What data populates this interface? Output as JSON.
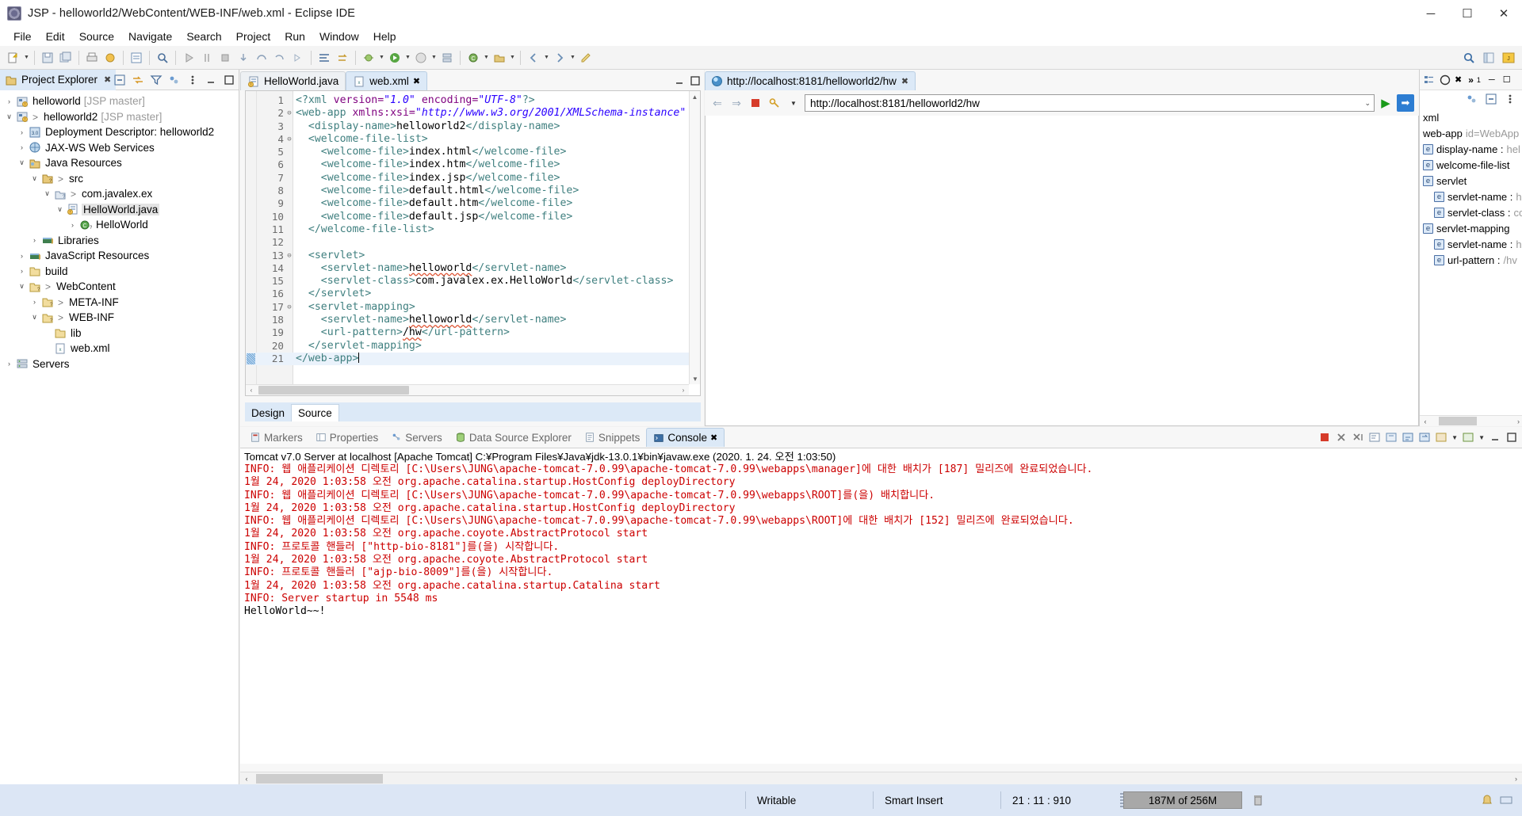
{
  "window": {
    "title": "JSP - helloworld2/WebContent/WEB-INF/web.xml - Eclipse IDE",
    "app_icon": "eclipse-icon",
    "minimize": "─",
    "maximize": "☐",
    "close": "✕"
  },
  "menu": {
    "items": [
      "File",
      "Edit",
      "Source",
      "Navigate",
      "Search",
      "Project",
      "Run",
      "Window",
      "Help"
    ]
  },
  "project_explorer": {
    "tab_label": "Project Explorer",
    "close_glyph": "✖",
    "tools": [
      "collapse-all-icon",
      "link-with-editor-icon",
      "view-filter-icon",
      "sync-icon",
      "view-menu-icon",
      "minimize-icon",
      "maximize-icon"
    ],
    "tree": [
      {
        "indent": 0,
        "twist": "›",
        "icon": "java-project-icon",
        "gt": "",
        "name": "helloworld",
        "suffix": "[JSP master]",
        "selected": false
      },
      {
        "indent": 0,
        "twist": "∨",
        "icon": "java-project-warn-icon",
        "gt": ">",
        "name": "helloworld2",
        "suffix": "[JSP master]",
        "selected": false
      },
      {
        "indent": 1,
        "twist": "›",
        "icon": "deployment-descriptor-icon",
        "gt": "",
        "name": "Deployment Descriptor: helloworld2",
        "suffix": "",
        "selected": false
      },
      {
        "indent": 1,
        "twist": "›",
        "icon": "jaxws-icon",
        "gt": "",
        "name": "JAX-WS Web Services",
        "suffix": "",
        "selected": false
      },
      {
        "indent": 1,
        "twist": "∨",
        "icon": "java-resources-icon",
        "gt": "",
        "name": "Java Resources",
        "suffix": "",
        "selected": false
      },
      {
        "indent": 2,
        "twist": "∨",
        "icon": "source-folder-icon",
        "gt": ">",
        "name": "src",
        "suffix": "",
        "selected": false
      },
      {
        "indent": 3,
        "twist": "∨",
        "icon": "package-icon",
        "gt": ">",
        "name": "com.javalex.ex",
        "suffix": "",
        "selected": false
      },
      {
        "indent": 4,
        "twist": "∨",
        "icon": "java-file-warn-icon",
        "gt": "",
        "name": "HelloWorld.java",
        "suffix": "",
        "selected": true
      },
      {
        "indent": 5,
        "twist": "›",
        "icon": "class-icon",
        "gt": "",
        "name": "HelloWorld",
        "suffix": "",
        "selected": false
      },
      {
        "indent": 2,
        "twist": "›",
        "icon": "library-icon",
        "gt": "",
        "name": "Libraries",
        "suffix": "",
        "selected": false
      },
      {
        "indent": 1,
        "twist": "›",
        "icon": "library-icon",
        "gt": "",
        "name": "JavaScript Resources",
        "suffix": "",
        "selected": false
      },
      {
        "indent": 1,
        "twist": "›",
        "icon": "folder-icon",
        "gt": "",
        "name": "build",
        "suffix": "",
        "selected": false
      },
      {
        "indent": 1,
        "twist": "∨",
        "icon": "folder-q-icon",
        "gt": ">",
        "name": "WebContent",
        "suffix": "",
        "selected": false
      },
      {
        "indent": 2,
        "twist": "›",
        "icon": "folder-q-icon",
        "gt": ">",
        "name": "META-INF",
        "suffix": "",
        "selected": false
      },
      {
        "indent": 2,
        "twist": "∨",
        "icon": "folder-q-icon",
        "gt": ">",
        "name": "WEB-INF",
        "suffix": "",
        "selected": false
      },
      {
        "indent": 3,
        "twist": "",
        "icon": "folder-icon",
        "gt": "",
        "name": "lib",
        "suffix": "",
        "selected": false
      },
      {
        "indent": 3,
        "twist": "",
        "icon": "xml-file-icon",
        "gt": "",
        "name": "web.xml",
        "suffix": "",
        "selected": false
      },
      {
        "indent": 0,
        "twist": "›",
        "icon": "servers-icon",
        "gt": "",
        "name": "Servers",
        "suffix": "",
        "selected": false
      }
    ]
  },
  "editor": {
    "tabs": [
      {
        "label": "HelloWorld.java",
        "icon": "java-file-warn-icon",
        "active": false,
        "closeable": false
      },
      {
        "label": "web.xml",
        "icon": "xml-file-icon",
        "active": true,
        "closeable": true
      }
    ],
    "close_glyph": "✖",
    "bottom_tabs": [
      {
        "label": "Design",
        "active": false
      },
      {
        "label": "Source",
        "active": true
      }
    ],
    "lines": [
      {
        "n": "1",
        "fold": "",
        "current": false,
        "html": "<span class='k-pi'>&lt;?xml </span><span class='k-attr'>version=</span><span class='k-str'>\"1.0\"</span><span class='k-attr'> encoding=</span><span class='k-str'>\"UTF-8\"</span><span class='k-pi'>?&gt;</span>"
      },
      {
        "n": "2",
        "fold": "⊖",
        "current": false,
        "html": "<span class='k-tag'>&lt;web-app </span><span class='k-attr'>xmlns:xsi=</span><span class='k-str'>\"http://www.w3.org/2001/XMLSchema-instance\"</span><span class='k-attr'> xmlns=</span><span class='k-str'>\"</span>"
      },
      {
        "n": "3",
        "fold": "",
        "current": false,
        "html": "  <span class='k-tag'>&lt;display-name&gt;</span><span class='k-txt'>helloworld2</span><span class='k-tag'>&lt;/display-name&gt;</span>"
      },
      {
        "n": "4",
        "fold": "⊖",
        "current": false,
        "html": "  <span class='k-tag'>&lt;welcome-file-list&gt;</span>"
      },
      {
        "n": "5",
        "fold": "",
        "current": false,
        "html": "    <span class='k-tag'>&lt;welcome-file&gt;</span><span class='k-txt'>index.html</span><span class='k-tag'>&lt;/welcome-file&gt;</span>"
      },
      {
        "n": "6",
        "fold": "",
        "current": false,
        "html": "    <span class='k-tag'>&lt;welcome-file&gt;</span><span class='k-txt'>index.htm</span><span class='k-tag'>&lt;/welcome-file&gt;</span>"
      },
      {
        "n": "7",
        "fold": "",
        "current": false,
        "html": "    <span class='k-tag'>&lt;welcome-file&gt;</span><span class='k-txt'>index.jsp</span><span class='k-tag'>&lt;/welcome-file&gt;</span>"
      },
      {
        "n": "8",
        "fold": "",
        "current": false,
        "html": "    <span class='k-tag'>&lt;welcome-file&gt;</span><span class='k-txt'>default.html</span><span class='k-tag'>&lt;/welcome-file&gt;</span>"
      },
      {
        "n": "9",
        "fold": "",
        "current": false,
        "html": "    <span class='k-tag'>&lt;welcome-file&gt;</span><span class='k-txt'>default.htm</span><span class='k-tag'>&lt;/welcome-file&gt;</span>"
      },
      {
        "n": "10",
        "fold": "",
        "current": false,
        "html": "    <span class='k-tag'>&lt;welcome-file&gt;</span><span class='k-txt'>default.jsp</span><span class='k-tag'>&lt;/welcome-file&gt;</span>"
      },
      {
        "n": "11",
        "fold": "",
        "current": false,
        "html": "  <span class='k-tag'>&lt;/welcome-file-list&gt;</span>"
      },
      {
        "n": "12",
        "fold": "",
        "current": false,
        "html": ""
      },
      {
        "n": "13",
        "fold": "⊖",
        "current": false,
        "html": "  <span class='k-tag'>&lt;servlet&gt;</span>"
      },
      {
        "n": "14",
        "fold": "",
        "current": false,
        "html": "    <span class='k-tag'>&lt;servlet-name&gt;</span><span class='k-txt squig'>helloworld</span><span class='k-tag'>&lt;/servlet-name&gt;</span>"
      },
      {
        "n": "15",
        "fold": "",
        "current": false,
        "html": "    <span class='k-tag'>&lt;servlet-class&gt;</span><span class='k-txt'>com.javalex.ex.HelloWorld</span><span class='k-tag'>&lt;/servlet-class&gt;</span>"
      },
      {
        "n": "16",
        "fold": "",
        "current": false,
        "html": "  <span class='k-tag'>&lt;/servlet&gt;</span>"
      },
      {
        "n": "17",
        "fold": "⊖",
        "current": false,
        "html": "  <span class='k-tag'>&lt;servlet-mapping&gt;</span>"
      },
      {
        "n": "18",
        "fold": "",
        "current": false,
        "html": "    <span class='k-tag'>&lt;servlet-name&gt;</span><span class='k-txt squig'>helloworld</span><span class='k-tag'>&lt;/servlet-name&gt;</span>"
      },
      {
        "n": "19",
        "fold": "",
        "current": false,
        "html": "    <span class='k-tag'>&lt;url-pattern&gt;</span><span class='k-txt squig'>/hw</span><span class='k-tag'>&lt;/url-pattern&gt;</span>"
      },
      {
        "n": "20",
        "fold": "",
        "current": false,
        "html": "  <span class='k-tag'>&lt;/servlet-mapping&gt;</span>"
      },
      {
        "n": "21",
        "fold": "",
        "current": true,
        "html": "<span class='k-tag'>&lt;/web-app&gt;</span><span class='caret'></span>"
      }
    ]
  },
  "browser": {
    "tab_label": "http://localhost:8181/helloworld2/hw",
    "tab_icon": "globe-icon",
    "close_glyph": "✖",
    "nav": {
      "back": "⇐",
      "forward": "⇒",
      "stop": "stop-icon",
      "bookmark": "bookmark-icon",
      "dropdown": "▼",
      "go": "▶",
      "open_external": "➡"
    },
    "url_value": "http://localhost:8181/helloworld2/hw",
    "url_chevron": "⌄"
  },
  "outline": {
    "tabs": [
      "outline-icon",
      "properties-icon"
    ],
    "close_glyph": "✖",
    "overflow": "»",
    "overflow_count": "1",
    "minimize": "─",
    "maximize": "☐",
    "tools": [
      "sync-icon",
      "collapse-all-icon",
      "view-menu-icon"
    ],
    "items": [
      {
        "indent": 0,
        "badge": "",
        "name": "xml",
        "value": ""
      },
      {
        "indent": 0,
        "badge": "",
        "name": "web-app",
        "value": "id=WebApp"
      },
      {
        "indent": 0,
        "badge": "e",
        "name": "display-name :",
        "value": "hel"
      },
      {
        "indent": 0,
        "badge": "e",
        "name": "welcome-file-list",
        "value": ""
      },
      {
        "indent": 0,
        "badge": "e",
        "name": "servlet",
        "value": ""
      },
      {
        "indent": 1,
        "badge": "e",
        "name": "servlet-name :",
        "value": "h"
      },
      {
        "indent": 1,
        "badge": "e",
        "name": "servlet-class :",
        "value": "co"
      },
      {
        "indent": 0,
        "badge": "e",
        "name": "servlet-mapping",
        "value": ""
      },
      {
        "indent": 1,
        "badge": "e",
        "name": "servlet-name :",
        "value": "h"
      },
      {
        "indent": 1,
        "badge": "e",
        "name": "url-pattern :",
        "value": "/hv"
      }
    ],
    "scroll_left": "‹",
    "scroll_right": "›"
  },
  "console": {
    "tabs": [
      {
        "label": "Markers",
        "icon": "markers-icon",
        "active": false
      },
      {
        "label": "Properties",
        "icon": "properties-icon",
        "active": false
      },
      {
        "label": "Servers",
        "icon": "servers-icon",
        "active": false
      },
      {
        "label": "Data Source Explorer",
        "icon": "datasource-icon",
        "active": false
      },
      {
        "label": "Snippets",
        "icon": "snippets-icon",
        "active": false
      },
      {
        "label": "Console",
        "icon": "console-icon",
        "active": true
      }
    ],
    "close_glyph": "✖",
    "tools": [
      "terminate-icon",
      "remove-icon",
      "remove-all-icon",
      "open-console-icon",
      "pin-icon",
      "scroll-lock-icon",
      "word-wrap-icon",
      "display-console-icon",
      "new-console-dropdown-icon",
      "minimize-icon",
      "maximize-icon"
    ],
    "header": "Tomcat v7.0 Server at localhost [Apache Tomcat] C:¥Program Files¥Java¥jdk-13.0.1¥bin¥javaw.exe (2020. 1. 24. 오전 1:03:50)",
    "log_lines": [
      "INFO: 웹 애플리케이션 디렉토리 [C:\\Users\\JUNG\\apache-tomcat-7.0.99\\apache-tomcat-7.0.99\\webapps\\manager]에 대한 배치가 [187] 밀리즈에 완료되었습니다.",
      "1월 24, 2020 1:03:58 오전 org.apache.catalina.startup.HostConfig deployDirectory",
      "INFO: 웹 애플리케이션 디렉토리 [C:\\Users\\JUNG\\apache-tomcat-7.0.99\\apache-tomcat-7.0.99\\webapps\\ROOT]를(을) 배치합니다.",
      "1월 24, 2020 1:03:58 오전 org.apache.catalina.startup.HostConfig deployDirectory",
      "INFO: 웹 애플리케이션 디렉토리 [C:\\Users\\JUNG\\apache-tomcat-7.0.99\\apache-tomcat-7.0.99\\webapps\\ROOT]에 대한 배치가 [152] 밀리즈에 완료되었습니다.",
      "1월 24, 2020 1:03:58 오전 org.apache.coyote.AbstractProtocol start",
      "INFO: 프로토콜 핸들러 [\"http-bio-8181\"]를(을) 시작합니다.",
      "1월 24, 2020 1:03:58 오전 org.apache.coyote.AbstractProtocol start",
      "INFO: 프로토콜 핸들러 [\"ajp-bio-8009\"]를(을) 시작합니다.",
      "1월 24, 2020 1:03:58 오전 org.apache.catalina.startup.Catalina start",
      "INFO: Server startup in 5548 ms"
    ],
    "final_line": "HelloWorld~~!",
    "scroll_left": "‹",
    "scroll_right": "›"
  },
  "statusbar": {
    "writable": "Writable",
    "insert_mode": "Smart Insert",
    "cursor_position": "21 : 11 : 910",
    "memory": "187M of 256M",
    "trash_icon": "trash-icon"
  },
  "colors": {
    "tab_active": "#dce9f7",
    "status_bg": "#dce6f5",
    "log_red": "#cc0000",
    "xml_tag": "#3f7f7f",
    "xml_attr": "#7f007f",
    "xml_string": "#2a00ff",
    "accent_blue": "#2d7dd2"
  }
}
